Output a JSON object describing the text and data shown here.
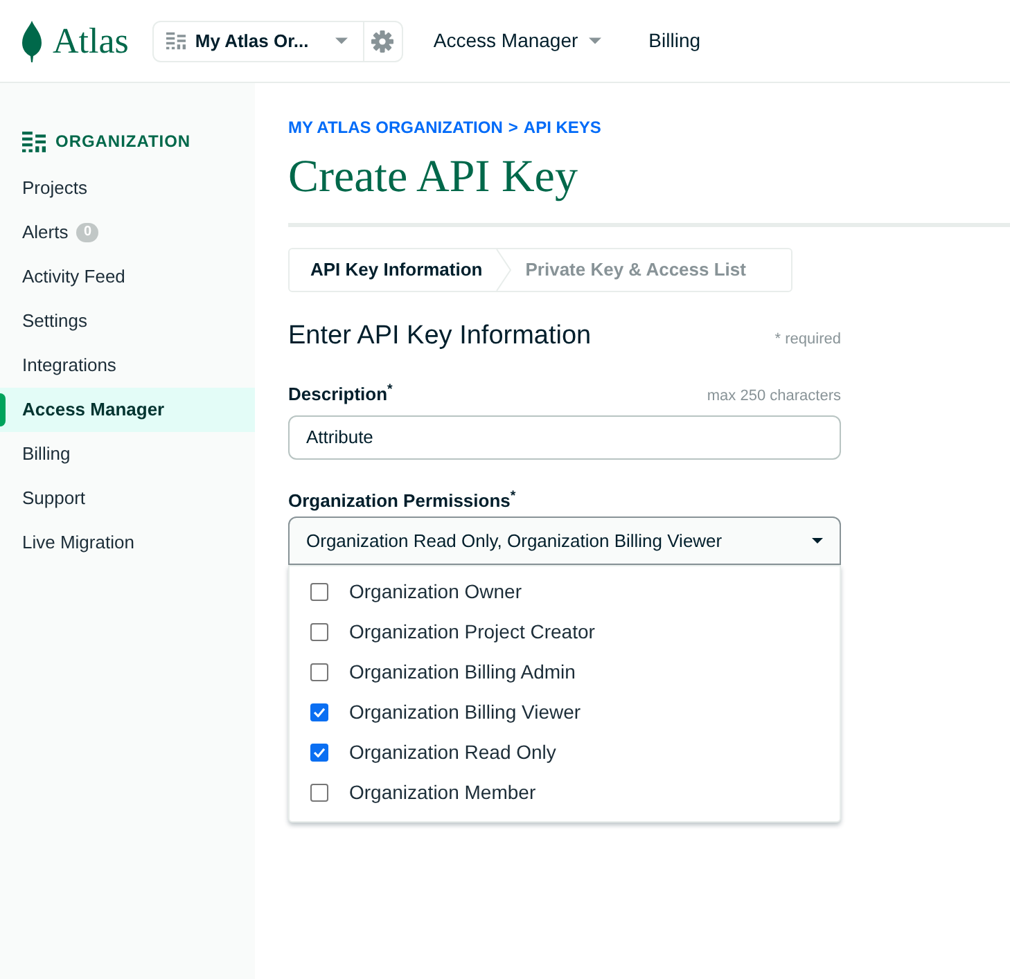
{
  "header": {
    "logo": "Atlas",
    "org_selector": "My Atlas Or...",
    "nav": [
      {
        "label": "Access Manager",
        "kind": "dropdown"
      },
      {
        "label": "Billing",
        "kind": "link"
      }
    ]
  },
  "sidebar": {
    "heading": "ORGANIZATION",
    "items": [
      {
        "label": "Projects",
        "selected": false
      },
      {
        "label": "Alerts",
        "badge": "0",
        "selected": false
      },
      {
        "label": "Activity Feed",
        "selected": false
      },
      {
        "label": "Settings",
        "selected": false
      },
      {
        "label": "Integrations",
        "selected": false
      },
      {
        "label": "Access Manager",
        "selected": true
      },
      {
        "label": "Billing",
        "selected": false
      },
      {
        "label": "Support",
        "selected": false
      },
      {
        "label": "Live Migration",
        "selected": false
      }
    ]
  },
  "breadcrumb": {
    "items": [
      "MY ATLAS ORGANIZATION",
      "API KEYS"
    ],
    "separator": ">"
  },
  "title": "Create API Key",
  "steps": [
    {
      "label": "API Key Information",
      "selected": true
    },
    {
      "label": "Private Key & Access List",
      "selected": false
    }
  ],
  "form": {
    "heading": "Enter API Key Information",
    "required_note": "* required",
    "description": {
      "label": "Description$^{*}$",
      "hint": "max 250 characters",
      "value": "Attribute"
    },
    "permissions": {
      "label": "Organization Permissions$^{*}$",
      "value": "Organization Read Only, Organization Billing Viewer",
      "expanded": true,
      "options": [
        {
          "label": "Organization Owner",
          "checked": false
        },
        {
          "label": "Organization Project Creator",
          "checked": false
        },
        {
          "label": "Organization Billing Admin",
          "checked": false
        },
        {
          "label": "Organization Billing Viewer",
          "checked": true
        },
        {
          "label": "Organization Read Only",
          "checked": true
        },
        {
          "label": "Organization Member",
          "checked": false
        }
      ]
    }
  }
}
